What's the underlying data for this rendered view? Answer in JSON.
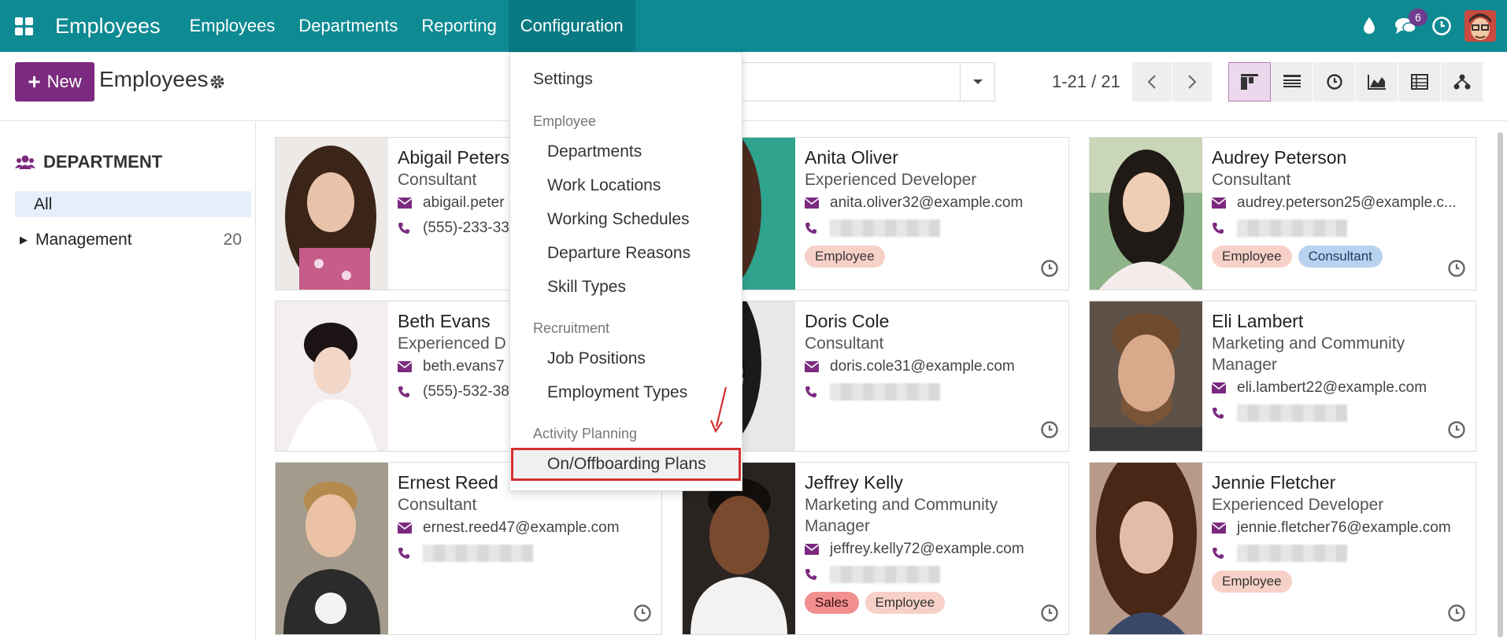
{
  "navbar": {
    "brand": "Employees",
    "menu": [
      "Employees",
      "Departments",
      "Reporting",
      "Configuration"
    ],
    "message_count": "6",
    "colors": {
      "bar": "#0e8a93",
      "active": "#0a7a82"
    }
  },
  "control": {
    "new_label": "New",
    "title": "Employees",
    "pager": "1-21 / 21"
  },
  "sidebar": {
    "header": "DEPARTMENT",
    "all_label": "All",
    "items": [
      {
        "label": "Management",
        "count": "20"
      }
    ]
  },
  "dropdown": {
    "settings": "Settings",
    "sections": [
      {
        "title": "Employee",
        "items": [
          "Departments",
          "Work Locations",
          "Working Schedules",
          "Departure Reasons",
          "Skill Types"
        ]
      },
      {
        "title": "Recruitment",
        "items": [
          "Job Positions",
          "Employment Types"
        ]
      },
      {
        "title": "Activity Planning",
        "items": [
          "On/Offboarding Plans"
        ]
      }
    ]
  },
  "employees": [
    {
      "name": "Abigail Peters",
      "job": "Consultant",
      "email": "abigail.peter",
      "phone": "(555)-233-33",
      "tags": []
    },
    {
      "name": "Anita Oliver",
      "job": "Experienced Developer",
      "email": "anita.oliver32@example.com",
      "phone": "",
      "tags": [
        "Employee"
      ]
    },
    {
      "name": "Audrey Peterson",
      "job": "Consultant",
      "email": "audrey.peterson25@example.c...",
      "phone": "",
      "tags": [
        "Employee",
        "Consultant"
      ]
    },
    {
      "name": "Beth Evans",
      "job": "Experienced D",
      "email": "beth.evans7",
      "phone": "(555)-532-38",
      "tags": []
    },
    {
      "name": "Doris Cole",
      "job": "Consultant",
      "email": "doris.cole31@example.com",
      "phone": "",
      "tags": []
    },
    {
      "name": "Eli Lambert",
      "job": "Marketing and Community Manager",
      "email": "eli.lambert22@example.com",
      "phone": "",
      "tags": []
    },
    {
      "name": "Ernest Reed",
      "job": "Consultant",
      "email": "ernest.reed47@example.com",
      "phone": "",
      "tags": []
    },
    {
      "name": "Jeffrey Kelly",
      "job": "Marketing and Community Manager",
      "email": "jeffrey.kelly72@example.com",
      "phone": "",
      "tags": [
        "Sales",
        "Employee"
      ]
    },
    {
      "name": "Jennie Fletcher",
      "job": "Experienced Developer",
      "email": "jennie.fletcher76@example.com",
      "phone": "",
      "tags": [
        "Employee"
      ]
    }
  ]
}
